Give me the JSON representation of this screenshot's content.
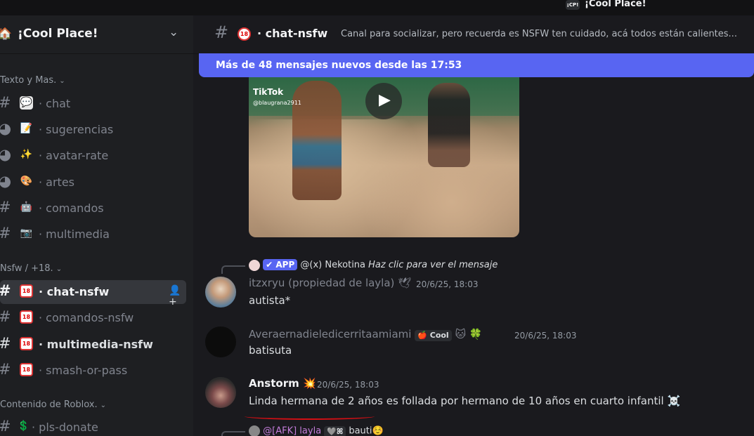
{
  "window": {
    "server_badge": "¡CP!",
    "title": "¡Cool Place!"
  },
  "sidebar": {
    "server_name": "¡Cool Place!",
    "server_icon": "house-icon",
    "categories": [
      {
        "label": "Texto y Mas.",
        "channels": [
          {
            "emoji": "💬",
            "label": "· chat"
          },
          {
            "emoji": "📝",
            "label": "· sugerencias"
          },
          {
            "emoji": "✨",
            "label": "· avatar-rate"
          },
          {
            "emoji": "🎨",
            "label": "· artes"
          },
          {
            "emoji": "🤖",
            "label": "· comandos"
          },
          {
            "emoji": "📷",
            "label": "· multimedia"
          }
        ]
      },
      {
        "label": "Nsfw / +18.",
        "channels": [
          {
            "emoji": "18",
            "label": "· chat-nsfw",
            "active": true
          },
          {
            "emoji": "18",
            "label": "· comandos-nsfw"
          },
          {
            "emoji": "18",
            "label": "· multimedia-nsfw",
            "unread": true
          },
          {
            "emoji": "18",
            "label": "· smash-or-pass"
          }
        ]
      },
      {
        "label": "Contenido de Roblox.",
        "channels": [
          {
            "emoji": "💲",
            "label": "· pls-donate"
          }
        ]
      }
    ]
  },
  "channel": {
    "age_badge": "18",
    "name": "· chat-nsfw",
    "topic": "Canal para socializar, pero recuerda es NSFW ten cuidado, acá todos están calientes..."
  },
  "new_messages_banner": "Más de 48 mensajes nuevos desde las 17:53",
  "video": {
    "brand": "TikTok",
    "handle": "@blaugrana2911"
  },
  "messages": [
    {
      "reply": {
        "badge": "✔ APP",
        "author": "@(x) Nekotina",
        "text": "Haz clic para ver el mensaje"
      },
      "author": "itzxryu (propiedad de layla)",
      "time": "20/6/25, 18:03",
      "text": "autista*"
    },
    {
      "author": "Averaernadieledicerritaamiami",
      "tag": "Cool",
      "time": "20/6/25, 18:03",
      "text": "batisuta"
    },
    {
      "author": "Anstorm",
      "time": "20/6/25, 18:03",
      "text": "Linda hermana de 2 años es follada por hermano de 10 años en cuarto infantil",
      "emoji": "☠️"
    },
    {
      "reply": {
        "author": "@[AFK] layla",
        "text": "bauti☺️"
      }
    }
  ],
  "colors": {
    "accent": "#5865f2",
    "active_channel_bg": "#35373c",
    "annotation_red": "#d40f14"
  }
}
